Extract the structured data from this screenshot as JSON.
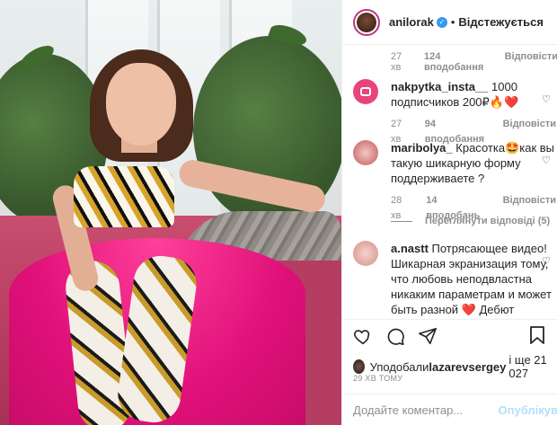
{
  "header": {
    "username": "anilorak",
    "separator": "•",
    "follow_status": "Відстежується"
  },
  "top_meta": {
    "time": "27 хв",
    "likes": "124 вподобання",
    "reply": "Відповісти"
  },
  "comments": [
    {
      "user": "nakpytka_insta__",
      "text": " 1000 подписчиков 200₽🔥❤️",
      "time": "27 хв",
      "likes": "94 вподобання",
      "reply": "Відповісти"
    },
    {
      "user": "maribolya_",
      "text": " Красотка🤩как вы такую шикарную форму поддерживаете ?",
      "time": "28 хв",
      "likes": "14 вподобань",
      "reply": "Відповісти"
    },
    {
      "user": "a.nastt",
      "text": " Потрясающее видео! Шикарная экранизация тому, что любовь неподвластна никаким параметрам и может быть разной ❤️ Дебют Сонечки - отдельный восторг! ❤️ ❤️ ❤️"
    }
  ],
  "view_replies": "Переглянути відповіді (5)",
  "likes_line": {
    "prefix": "Уподобали ",
    "user": "lazarevsergey",
    "suffix": " і ще 21 027"
  },
  "post_time": "29 ХВ ТОМУ",
  "add_comment": {
    "placeholder": "Додайте коментар...",
    "publish": "Опублікув"
  },
  "icons": {
    "like": "heart-icon",
    "comment": "comment-icon",
    "share": "send-icon",
    "save": "bookmark-icon",
    "verified": "verified-badge-icon",
    "comment_like": "small-heart-icon"
  },
  "colors": {
    "verified": "#3897f0",
    "publish": "#b2dffc",
    "meta": "#8e8e8e"
  }
}
